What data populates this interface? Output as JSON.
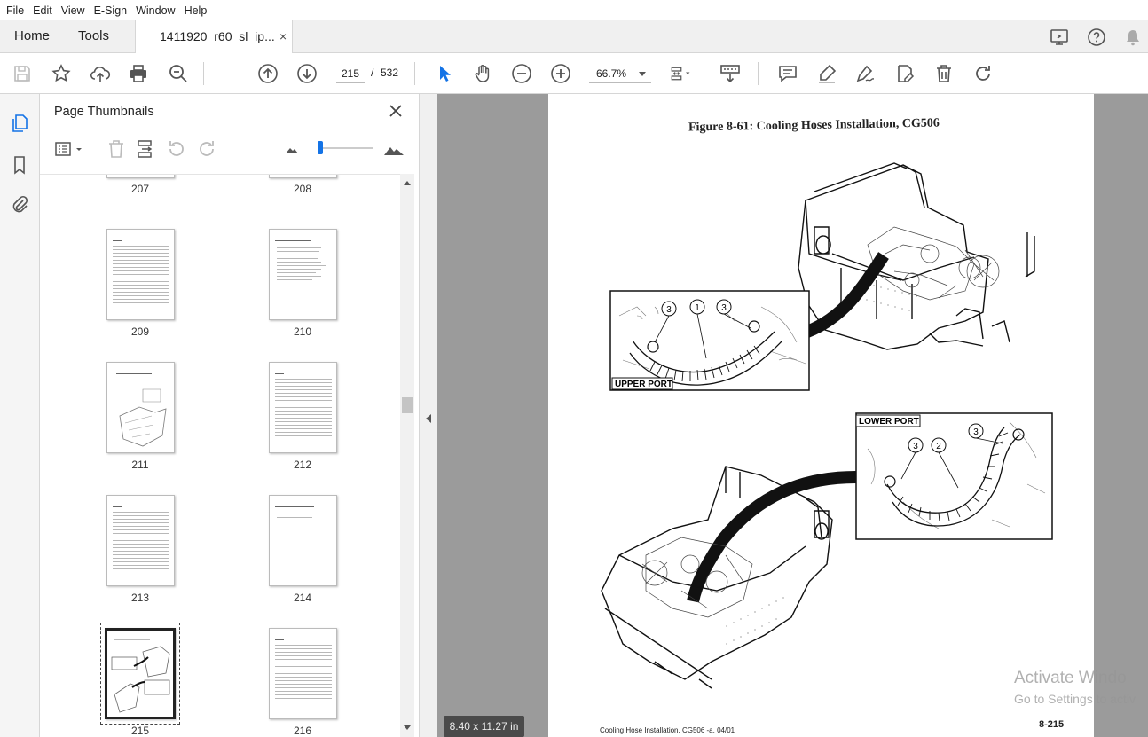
{
  "menu": [
    "File",
    "Edit",
    "View",
    "E-Sign",
    "Window",
    "Help"
  ],
  "tabs": {
    "home": "Home",
    "tools": "Tools",
    "document": "1411920_r60_sl_ip...",
    "close": "×"
  },
  "toolbar": {
    "page_current": "215",
    "page_separator": "/",
    "page_total": "532",
    "zoom": "66.7%"
  },
  "panel": {
    "title": "Page Thumbnails"
  },
  "thumbnails": [
    {
      "label": "207"
    },
    {
      "label": "208"
    },
    {
      "label": "209"
    },
    {
      "label": "210"
    },
    {
      "label": "211"
    },
    {
      "label": "212"
    },
    {
      "label": "213"
    },
    {
      "label": "214"
    },
    {
      "label": "215"
    },
    {
      "label": "216"
    }
  ],
  "document": {
    "figure_title": "Figure 8-61:  Cooling Hoses Installation, CG506",
    "upper_port_label": "UPPER PORT",
    "lower_port_label": "LOWER PORT",
    "callouts_upper": [
      "3",
      "1",
      "3"
    ],
    "callouts_lower": [
      "3",
      "2",
      "3"
    ],
    "footer_left": "Cooling Hose Installation, CG506 -a, 04/01",
    "footer_right": "8-215"
  },
  "page_size_badge": "8.40 x 11.27 in",
  "watermark": {
    "line1": "Activate Windo",
    "line2": "Go to Settings to activ"
  },
  "colors": {
    "accent": "#1473e6",
    "viewer_bg": "#9b9b9b",
    "tab_bar": "#f0f0f0"
  }
}
